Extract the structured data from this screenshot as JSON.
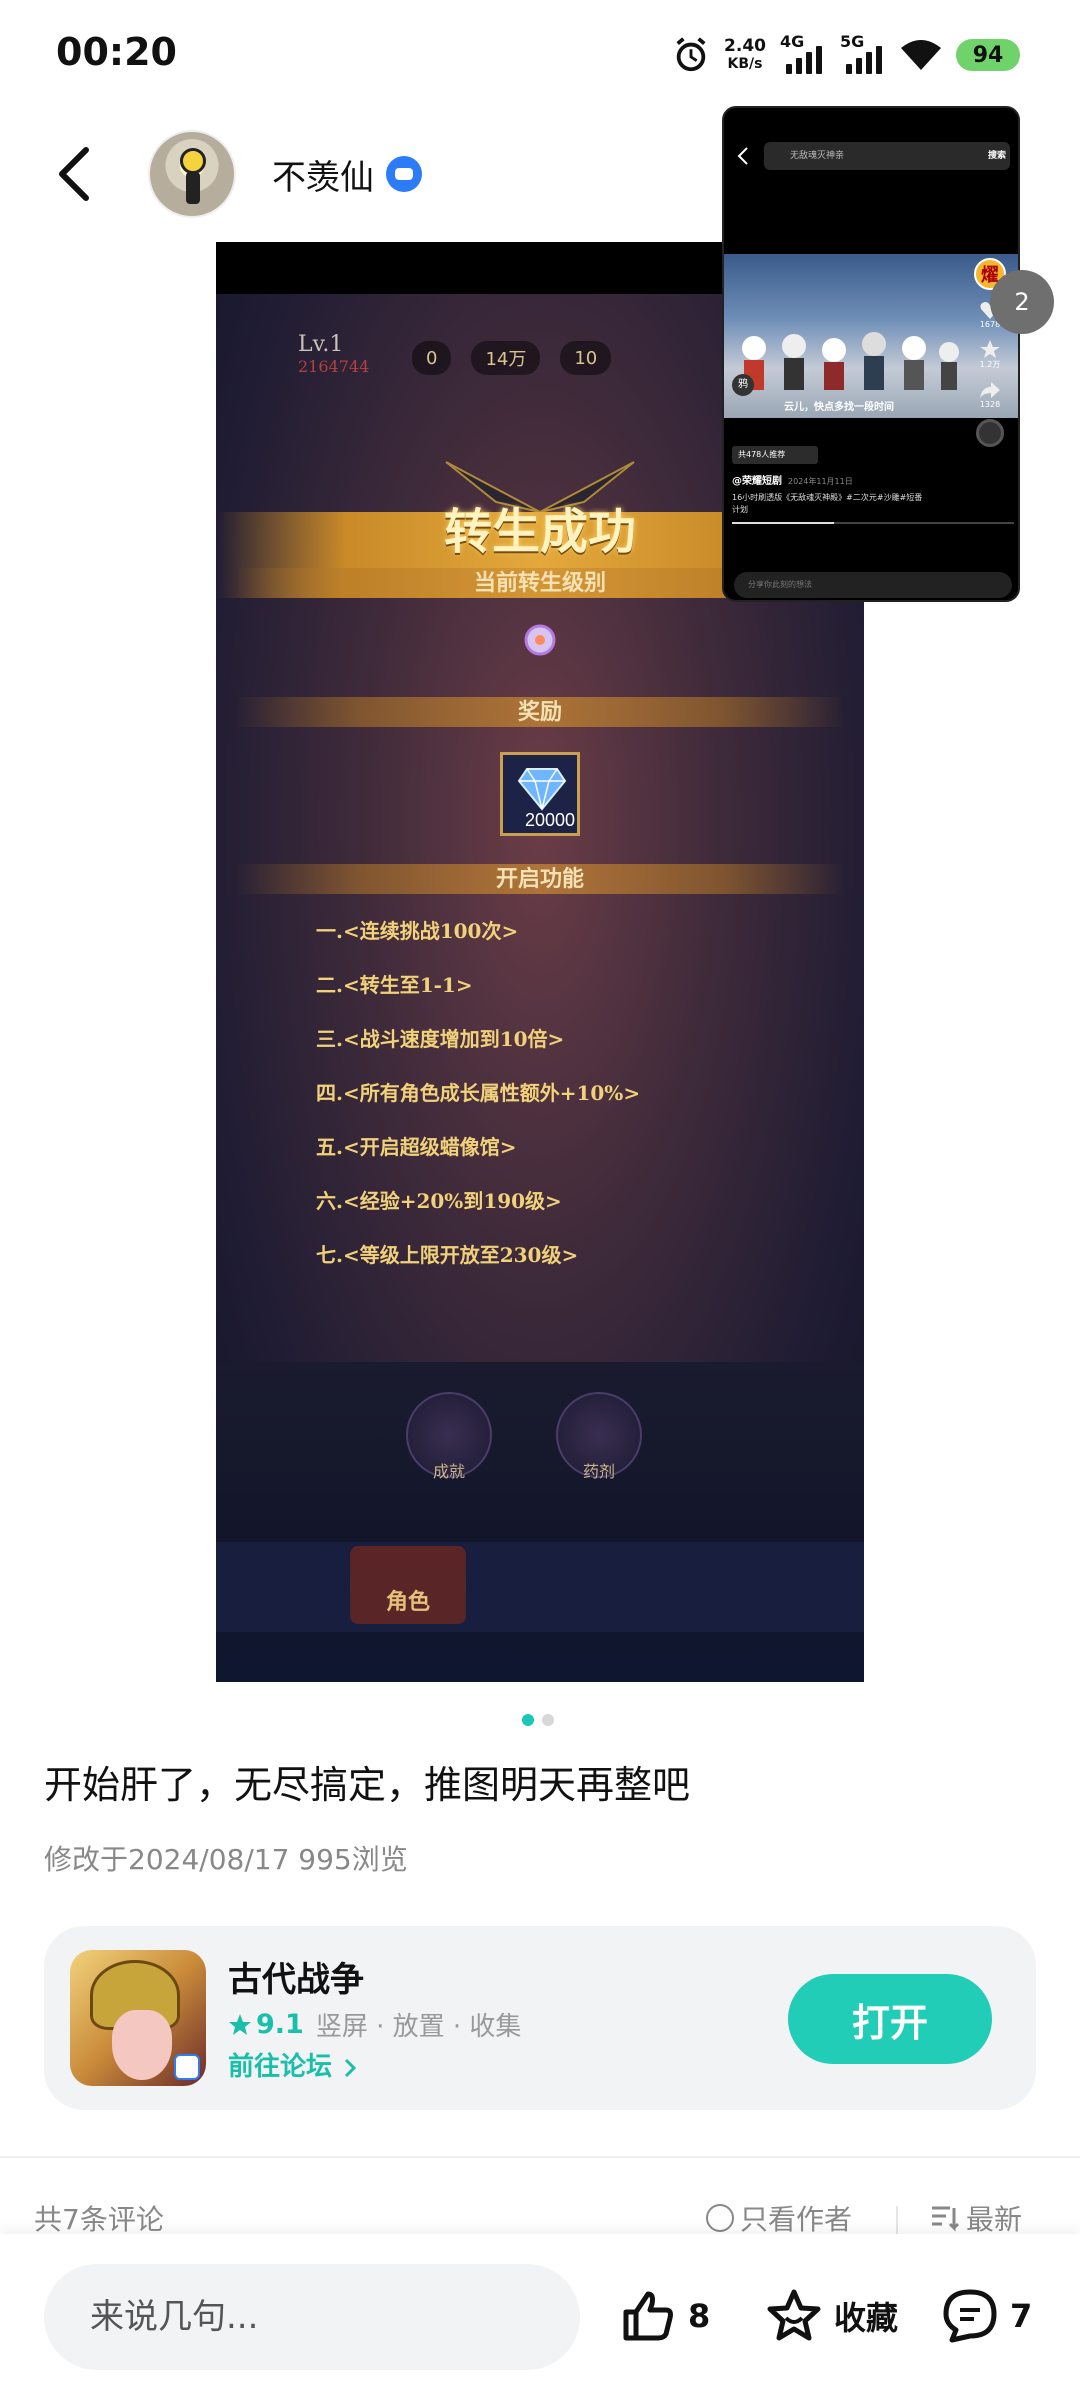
{
  "status_bar": {
    "time": "00:20",
    "net_speed": "2.40",
    "net_speed_unit": "KB/s",
    "sim1": "4G",
    "sim2": "5G",
    "battery": "94"
  },
  "header": {
    "username": "不羡仙"
  },
  "game_screenshot": {
    "level": "Lv.1",
    "level_value": "2164744",
    "hud_values": [
      "0",
      "14万",
      "10"
    ],
    "title": "转生成功",
    "current_rebirth_label": "当前转生级别",
    "reward_label": "奖励",
    "reward_quantity": "20000",
    "unlock_label": "开启功能",
    "features": [
      "一.<连续挑战100次>",
      "二.<转生至1-1>",
      "三.<战斗速度增加到10倍>",
      "四.<所有角色成长属性额外+10%>",
      "五.<开启超级蜡像馆>",
      "六.<经验+20%到190级>",
      "七.<等级上限开放至230级>"
    ],
    "bottom_buttons": [
      "成就",
      "药剂"
    ],
    "active_tab": "角色"
  },
  "floating_video": {
    "search_text": "无敌魂灭神亲",
    "search_button": "搜索",
    "subtitle": "云儿，快点多找一段时间",
    "avatar_badge": "燿",
    "side_counts": [
      "1678",
      "1.2万",
      "1328"
    ],
    "recommend_tag": "共478人推荐",
    "author": "@荣耀短剧",
    "date": "2024年11月11日",
    "description": "16小时刷透版《无敌魂灭神殿》#二次元#沙雕#短番",
    "description_more": "计划",
    "comment_placeholder": "分享你此刻的想法",
    "corner_small_icon": "鸦",
    "side_circle_text": "2"
  },
  "post": {
    "text": "开始肝了，无尽搞定，推图明天再整吧",
    "meta": "修改于2024/08/17  995浏览",
    "page_count": 2,
    "active_page": 1
  },
  "app_card": {
    "name": "古代战争",
    "rating": "9.1",
    "tags": "竖屏 · 放置 · 收集",
    "forum_link": "前往论坛",
    "open_button": "打开"
  },
  "comments": {
    "count_label": "共7条评论",
    "author_only": "只看作者",
    "sort": "最新"
  },
  "bottom_bar": {
    "input_placeholder": "来说几句...",
    "likes": "8",
    "favorite": "收藏",
    "comments": "7"
  },
  "colors": {
    "accent": "#22cdb7",
    "battery": "#6fd26a",
    "verified": "#2b7cf6"
  },
  "icons": [
    "alarm-icon",
    "signal-icon",
    "wifi-icon",
    "back-icon",
    "verified-icon",
    "diamond-icon",
    "star-icon",
    "chevron-right-icon",
    "thumbs-up-icon",
    "star-outline-icon",
    "comment-icon",
    "sort-icon"
  ]
}
